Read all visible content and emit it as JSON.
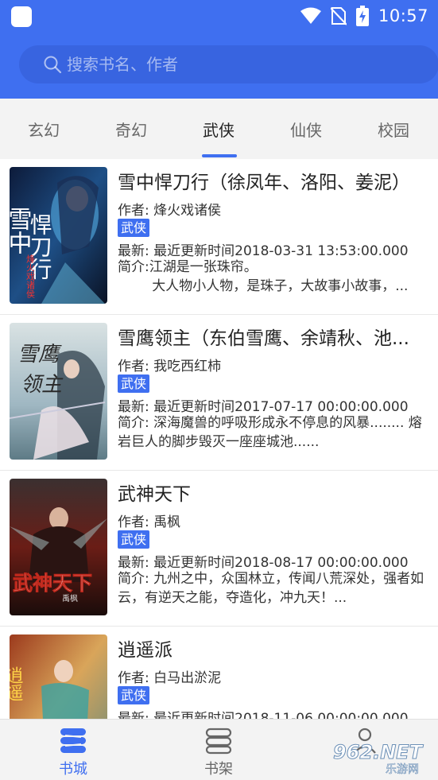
{
  "status_bar": {
    "time": "10:57",
    "icons": [
      "wifi-icon",
      "no-sim-icon",
      "battery-charging-icon"
    ]
  },
  "search": {
    "placeholder": "搜索书名、作者",
    "icon": "search-icon"
  },
  "tabs": [
    {
      "label": "玄幻",
      "active": false
    },
    {
      "label": "奇幻",
      "active": false
    },
    {
      "label": "武侠",
      "active": true
    },
    {
      "label": "仙侠",
      "active": false
    },
    {
      "label": "校园",
      "active": false
    }
  ],
  "books": [
    {
      "title": "雪中悍刀行（徐凤年、洛阳、姜泥）",
      "author": "作者: 烽火戏诸侯",
      "tag": "武侠",
      "update": "最新: 最近更新时间2018-03-31 13:53:00.000",
      "intro": "简介:江湖是一张珠帘。\n        大人物小人物，是珠子，大故事小故事，...",
      "cover_text": [
        "雪中",
        "悍刀行"
      ],
      "cover_sub": "烽火戏诸侯"
    },
    {
      "title": "雪鹰领主（东伯雪鹰、余靖秋、池...",
      "author": "作者: 我吃西红柿",
      "tag": "武侠",
      "update": "最新: 最近更新时间2017-07-17 00:00:00.000",
      "intro": "简介:        深海魔兽的呼吸形成永不停息的风暴........         熔岩巨人的脚步毁灭一座座城池......",
      "cover_text": [
        "雪鹰",
        "领主"
      ],
      "cover_sub": ""
    },
    {
      "title": "武神天下",
      "author": "作者: 禹枫",
      "tag": "武侠",
      "update": "最新: 最近更新时间2018-08-17 00:00:00.000",
      "intro": "简介:        九州之中，众国林立，传闻八荒深处，强者如云，有逆天之能，夺造化，冲九天！...",
      "cover_text": [
        "武神天下"
      ],
      "cover_sub": "禹枫"
    },
    {
      "title": "逍遥派",
      "author": "作者: 白马出淤泥",
      "tag": "武侠",
      "update": "最新: 最近更新时间2018-11-06 00:00:00.000",
      "intro": "",
      "cover_text": [
        "逍遥"
      ],
      "cover_sub": ""
    }
  ],
  "bottom_nav": [
    {
      "label": "书城",
      "icon": "bookstore-icon",
      "active": true
    },
    {
      "label": "书架",
      "icon": "bookshelf-icon",
      "active": false
    },
    {
      "label": "",
      "icon": "profile-icon",
      "active": false
    }
  ],
  "watermark": {
    "text": "962.NET",
    "sub": "乐游网"
  },
  "colors": {
    "primary": "#3f6ff0",
    "tab_bg": "#f3f3f3"
  }
}
